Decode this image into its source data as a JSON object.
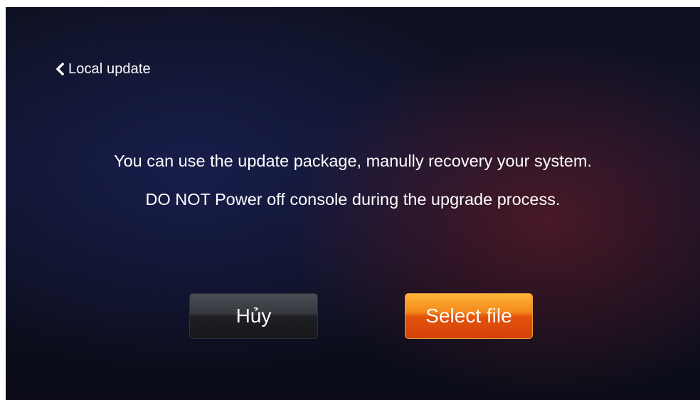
{
  "header": {
    "back_icon": "chevron-left-icon",
    "title": "Local update"
  },
  "message": {
    "line1": "You can use the update package, manully recovery your system.",
    "line2": "DO NOT Power off console during the upgrade process."
  },
  "buttons": {
    "cancel_label": "Hủy",
    "select_label": "Select file"
  },
  "colors": {
    "select_button": "#f07a18",
    "cancel_button": "#2a2b30",
    "background": "#10132a",
    "text": "#ffffff"
  }
}
